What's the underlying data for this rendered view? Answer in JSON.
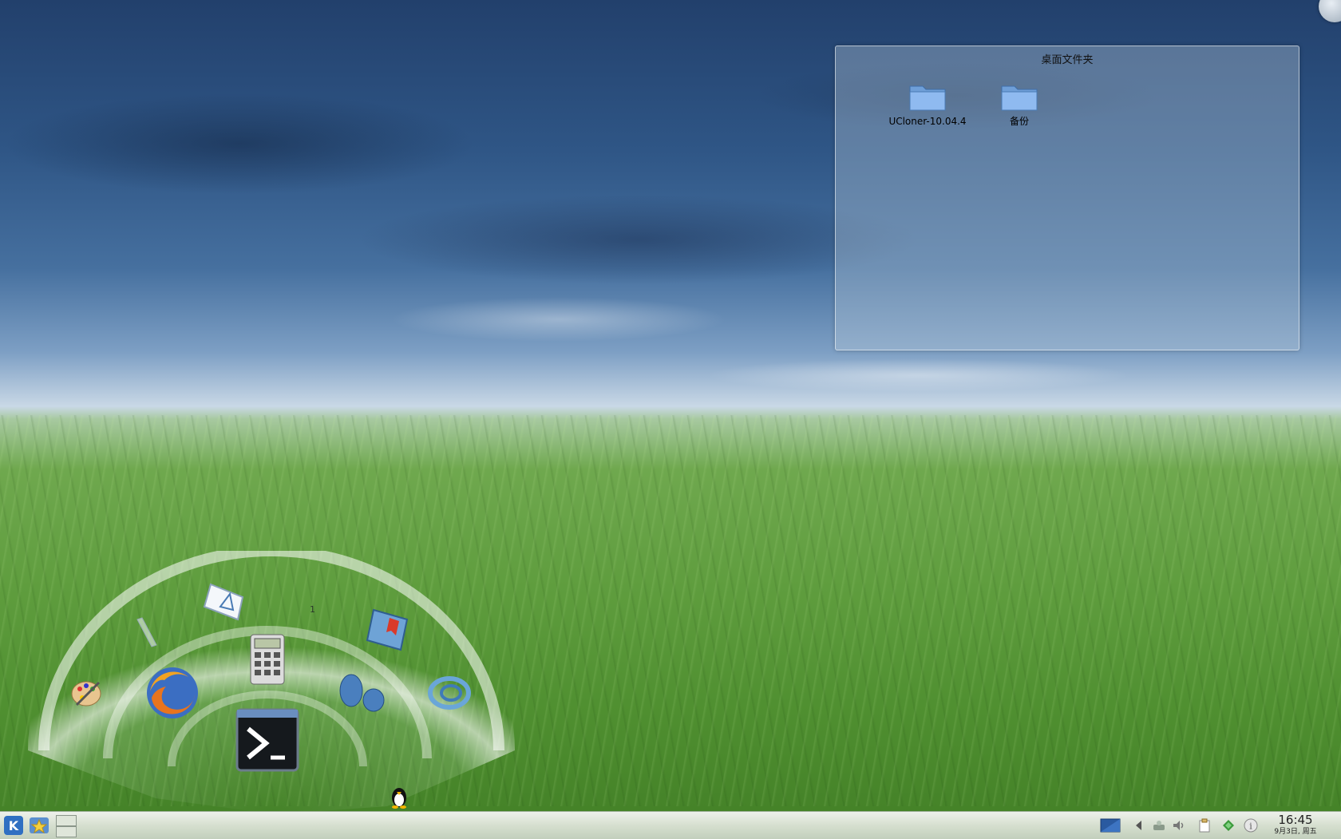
{
  "desktop": {
    "folder_view": {
      "title": "桌面文件夹",
      "items": [
        {
          "label": "UCloner-10.04.4",
          "icon": "folder-icon"
        },
        {
          "label": "备份",
          "icon": "folder-icon"
        }
      ]
    },
    "launcher": {
      "items": [
        {
          "name": "paint-app",
          "icon": "palette-icon"
        },
        {
          "name": "pencil-app",
          "icon": "pencil-icon"
        },
        {
          "name": "document-app",
          "icon": "document-icon"
        },
        {
          "name": "calculator-app",
          "icon": "calculator-icon"
        },
        {
          "name": "book-app",
          "icon": "book-icon"
        },
        {
          "name": "firefox-app",
          "icon": "firefox-icon"
        },
        {
          "name": "pidgin-app",
          "icon": "footprints-icon"
        },
        {
          "name": "chat-app",
          "icon": "chat-bubble-icon"
        },
        {
          "name": "terminal-app",
          "icon": "terminal-icon"
        },
        {
          "name": "penguin-app",
          "icon": "penguin-icon"
        }
      ],
      "small_label": "1"
    }
  },
  "taskbar": {
    "start_icon": "kde-start-icon",
    "favorites_icon": "star-icon",
    "pager_icon": "pager-icon",
    "tray_icons": [
      "desktop-icon",
      "arrow-left-icon",
      "network-icon",
      "volume-icon",
      "clipboard-icon",
      "update-icon",
      "info-icon"
    ],
    "clock": {
      "time": "16:45",
      "date": "9月3日, 周五"
    }
  }
}
